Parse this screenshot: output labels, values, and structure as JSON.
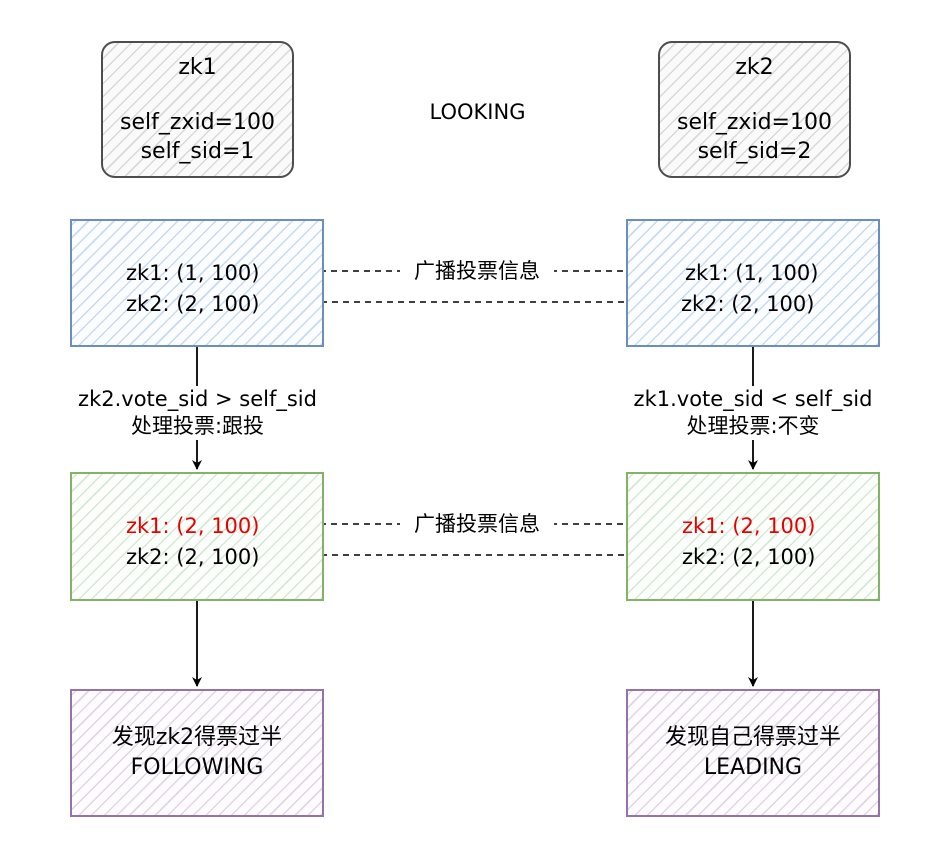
{
  "status_label": "LOOKING",
  "servers": {
    "zk1": {
      "name": "zk1",
      "zxid": "self_zxid=100",
      "sid": "self_sid=1"
    },
    "zk2": {
      "name": "zk2",
      "zxid": "self_zxid=100",
      "sid": "self_sid=2"
    }
  },
  "round1": {
    "left": {
      "vote1": "zk1: (1, 100)",
      "vote2": "zk2: (2, 100)"
    },
    "right": {
      "vote1": "zk1: (1, 100)",
      "vote2": "zk2: (2, 100)"
    },
    "broadcast_label": "广播投票信息"
  },
  "decisions": {
    "left": {
      "condition": "zk2.vote_sid > self_sid",
      "action": "处理投票:跟投"
    },
    "right": {
      "condition": "zk1.vote_sid < self_sid",
      "action": "处理投票:不变"
    }
  },
  "round2": {
    "left": {
      "vote1": "zk1: (2, 100)",
      "vote2": "zk2: (2, 100)"
    },
    "right": {
      "vote1": "zk1: (2, 100)",
      "vote2": "zk2: (2, 100)"
    },
    "broadcast_label": "广播投票信息",
    "changed_vote_color": "#e60000"
  },
  "results": {
    "left": {
      "line1": "发现zk2得票过半",
      "line2": "FOLLOWING"
    },
    "right": {
      "line1": "发现自己得票过半",
      "line2": "LEADING"
    }
  },
  "colors": {
    "server_border": "#4d4d4d",
    "round1_border": "#6c8ebf",
    "round2_border": "#82b366",
    "result_border": "#9673a6"
  }
}
